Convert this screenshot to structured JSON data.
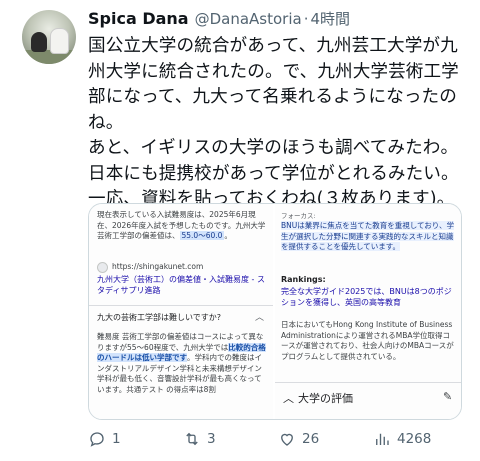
{
  "post": {
    "display_name": "Spica Dana",
    "handle": "@DanaAstoria",
    "separator": "·",
    "time": "4時間",
    "lines": [
      "国公立大学の統合があって、九州芸工大学が九",
      "州大学に統合されたの。で、九州大学芸術工学",
      "部になって、九大って名乗れるようになったの",
      "ね。",
      "あと、イギリスの大学のほうも調べてみたわ。",
      "日本にも提携校があって学位がとれるみたい。",
      "一応、資料を貼っておくわね(３枚あります)。"
    ]
  },
  "image_left": {
    "intro_text": "現在表示している入試難易度は、2025年6月現在、2026年度入試を予想したものです。九州大学芸術工学部の偏差値は、",
    "intro_highlight": "55.0〜60.0",
    "intro_end": "。",
    "site_url": "https://shingakunet.com",
    "link_text": "九州大学（芸術工）の偏差値・入試難易度 - スタディサプリ進路",
    "question": "九大の芸術工学部は難しいですか?",
    "answer_start": "難易度 芸術工学部の偏差値はコースによって異なりますが55〜60程度で、九州大学では",
    "answer_bold": "比較的合格のハードルは低い学部です",
    "answer_end": "。学科内での難度はインダストリアルデザイン学科と未来構想デザイン学科が最も低く、音響設計学科が最も高くなっています。共通テスト の得点率は8割"
  },
  "image_right": {
    "label": "フォーカス:",
    "para1": "BNUは業界に焦点を当てた教育を重視しており、学生が選択した分野に関連する実践的なスキルと知識を提供することを優先しています。",
    "rankings_title": "Rankings:",
    "rankings_text": "完全な大学ガイド2025では、BNUは8つのポジションを獲得し、英国の高等教育",
    "para2": "日本においてもHong Kong Institute of Business Administrationにより運営されるMBA学位取得コースが運営されており、社会人向けのMBAコースがプログラムとして提供されている。",
    "eval_label": "大学の評価",
    "chevron_icon": "chevron-up-icon",
    "pencil_icon": "pencil-icon"
  },
  "actions": {
    "reply_count": "1",
    "repost_count": "3",
    "like_count": "26",
    "views_count": "4268"
  },
  "colors": {
    "text": "#0f1419",
    "muted": "#536471",
    "link": "#1a0dab",
    "highlight": "#d2e3fc"
  }
}
